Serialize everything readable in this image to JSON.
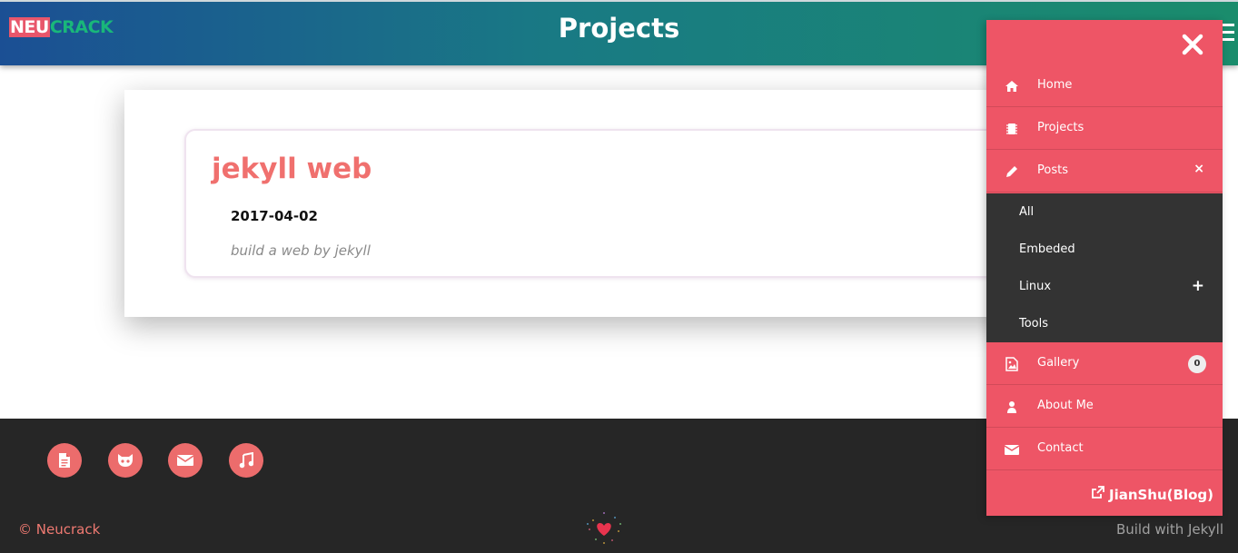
{
  "header": {
    "logo_part1": "NEU",
    "logo_part2": "CRACK",
    "title": "Projects"
  },
  "post": {
    "title": "jekyll web",
    "date": "2017-04-02",
    "description": "build a web by jekyll"
  },
  "menu": {
    "items": [
      {
        "label": "Home",
        "icon": "home-icon"
      },
      {
        "label": "Projects",
        "icon": "chip-icon"
      },
      {
        "label": "Posts",
        "icon": "pencil-icon",
        "toggle": "×"
      },
      {
        "label": "Gallery",
        "icon": "image-file-icon",
        "badge": "0"
      },
      {
        "label": "About Me",
        "icon": "user-icon"
      },
      {
        "label": "Contact",
        "icon": "envelope-icon"
      }
    ],
    "submenu": [
      {
        "label": "All"
      },
      {
        "label": "Embeded"
      },
      {
        "label": "Linux",
        "toggle": "+"
      },
      {
        "label": "Tools"
      }
    ],
    "blog_link": "JianShu(Blog)"
  },
  "footer": {
    "copyright": "© Neucrack",
    "built_with": "Build with Jekyll",
    "social_icons": [
      "document-icon",
      "github-icon",
      "envelope-icon",
      "music-icon"
    ]
  },
  "colors": {
    "accent": "#ee5566",
    "title_color": "#f0706e",
    "footer_bg": "#262626",
    "submenu_bg": "#333333"
  }
}
